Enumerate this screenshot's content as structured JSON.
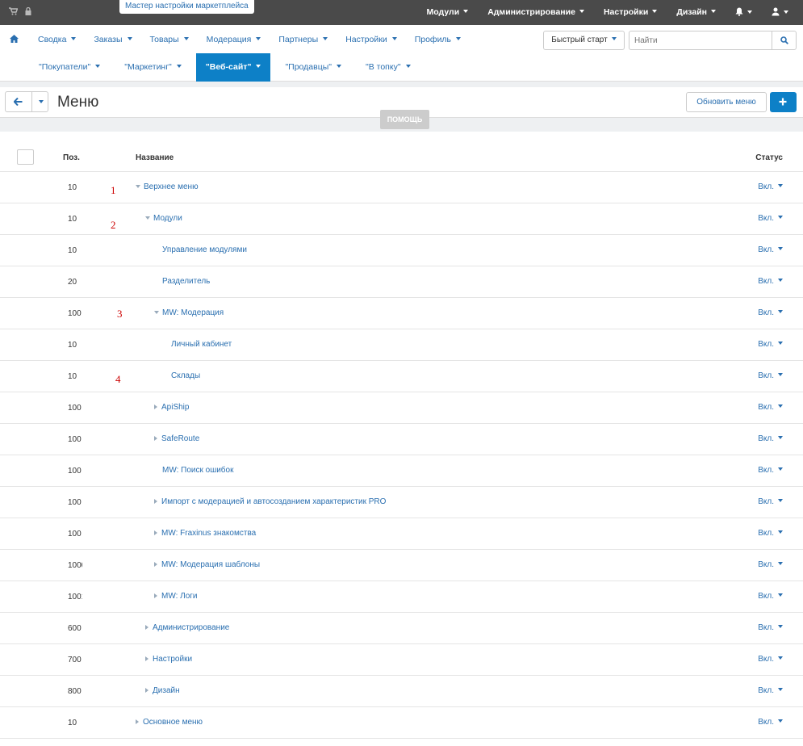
{
  "top": {
    "wizard": "Мастер настройки маркетплейса",
    "menu": [
      "Модули",
      "Администрирование",
      "Настройки",
      "Дизайн"
    ]
  },
  "nav": {
    "row1": [
      "Сводка",
      "Заказы",
      "Товары",
      "Модерация",
      "Партнеры",
      "Настройки",
      "Профиль"
    ],
    "row2": [
      "\"Покупатели\"",
      "\"Маркетинг\"",
      "\"Веб-сайт\"",
      "\"Продавцы\"",
      "\"В топку\""
    ],
    "active_index": 2,
    "quick_start": "Быстрый старт",
    "search_placeholder": "Найти"
  },
  "page": {
    "title": "Меню",
    "refresh_label": "Обновить меню",
    "help_label": "ПОМОЩЬ"
  },
  "table": {
    "headers": {
      "pos": "Поз.",
      "name": "Название",
      "status": "Статус"
    },
    "rows": [
      {
        "pos": "10",
        "name": "Верхнее меню",
        "level": 0,
        "toggle": "down",
        "status": "Вкл."
      },
      {
        "pos": "10",
        "name": "Модули",
        "level": 1,
        "toggle": "down",
        "status": "Вкл."
      },
      {
        "pos": "10",
        "name": "Управление модулями",
        "level": 2,
        "toggle": "none",
        "status": "Вкл."
      },
      {
        "pos": "20",
        "name": "Разделитель",
        "level": 2,
        "toggle": "none",
        "status": "Вкл."
      },
      {
        "pos": "100",
        "name": "MW: Модерация",
        "level": 2,
        "toggle": "down",
        "status": "Вкл."
      },
      {
        "pos": "10",
        "name": "Личный кабинет",
        "level": 3,
        "toggle": "none",
        "status": "Вкл."
      },
      {
        "pos": "10",
        "name": "Склады",
        "level": 3,
        "toggle": "none",
        "status": "Вкл."
      },
      {
        "pos": "100",
        "name": "ApiShip",
        "level": 2,
        "toggle": "right",
        "status": "Вкл."
      },
      {
        "pos": "100",
        "name": "SafeRoute",
        "level": 2,
        "toggle": "right",
        "status": "Вкл."
      },
      {
        "pos": "100",
        "name": "MW: Поиск ошибок",
        "level": 2,
        "toggle": "none",
        "status": "Вкл."
      },
      {
        "pos": "100",
        "name": "Импорт с модерацией и автосозданием характеристик PRO",
        "level": 2,
        "toggle": "right",
        "status": "Вкл."
      },
      {
        "pos": "100",
        "name": "MW: Fraxinus знакомства",
        "level": 2,
        "toggle": "right",
        "status": "Вкл."
      },
      {
        "pos": "1000",
        "name": "MW: Модерация шаблоны",
        "level": 2,
        "toggle": "right",
        "status": "Вкл."
      },
      {
        "pos": "1001",
        "name": "MW: Логи",
        "level": 2,
        "toggle": "right",
        "status": "Вкл."
      },
      {
        "pos": "600",
        "name": "Администрирование",
        "level": 1,
        "toggle": "right",
        "status": "Вкл."
      },
      {
        "pos": "700",
        "name": "Настройки",
        "level": 1,
        "toggle": "right",
        "status": "Вкл."
      },
      {
        "pos": "800",
        "name": "Дизайн",
        "level": 1,
        "toggle": "right",
        "status": "Вкл."
      },
      {
        "pos": "10",
        "name": "Основное меню",
        "level": 0,
        "toggle": "right",
        "status": "Вкл."
      }
    ]
  },
  "annotations": [
    "1",
    "2",
    "3",
    "4"
  ]
}
